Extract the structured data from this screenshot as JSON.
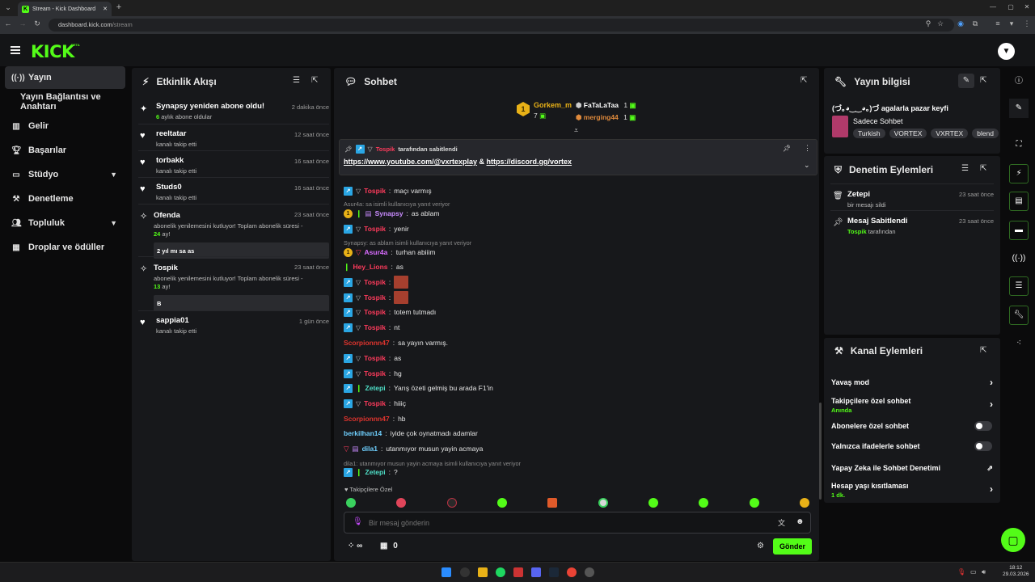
{
  "browser": {
    "tab_title": "Stream - Kick Dashboard",
    "url_host": "dashboard.kick.com",
    "url_path": "/stream"
  },
  "header": {
    "logo": "KICK",
    "beta": "BETA"
  },
  "sidebar": {
    "items": [
      {
        "label": "Yayın",
        "icon": "broadcast-icon"
      },
      {
        "label": "Yayın Bağlantısı ve Anahtarı",
        "icon": ""
      },
      {
        "label": "Gelir",
        "icon": "chart-icon"
      },
      {
        "label": "Başarılar",
        "icon": "trophy-icon"
      },
      {
        "label": "Stüdyo",
        "icon": "studio-icon"
      },
      {
        "label": "Denetleme",
        "icon": "hammer-icon"
      },
      {
        "label": "Topluluk",
        "icon": "people-icon"
      },
      {
        "label": "Droplar ve ödüller",
        "icon": "gift-icon"
      }
    ]
  },
  "activity": {
    "title": "Etkinlik Akışı",
    "items": [
      {
        "name": "Synapsy yeniden abone oldu!",
        "time": "2 dakika önce",
        "sub_num": "6",
        "sub_text": " aylık abone oldular"
      },
      {
        "name": "reeltatar",
        "time": "12 saat önce",
        "sub": "kanalı takip etti"
      },
      {
        "name": "torbakk",
        "time": "16 saat önce",
        "sub": "kanalı takip etti"
      },
      {
        "name": "Studs0",
        "time": "16 saat önce",
        "sub": "kanalı takip etti"
      },
      {
        "name": "Ofenda",
        "time": "23 saat önce",
        "sub": "abonelik yenilemesini kutluyor! Toplam abonelik süresi -",
        "num": "24",
        "unit": " ay!",
        "box": "2 yıl mı sa as"
      },
      {
        "name": "Tospik",
        "time": "23 saat önce",
        "sub": "abonelik yenilemesini kutluyor! Toplam abonelik süresi -",
        "num": "13",
        "unit": " ay!",
        "box": "B"
      },
      {
        "name": "sappia01",
        "time": "1 gün önce",
        "sub": "kanalı takip etti"
      }
    ]
  },
  "chat": {
    "title": "Sohbet",
    "leaderboard": {
      "first": "Gorkem_m",
      "first_count": "7",
      "second": "FaTaLaTaa",
      "second_count": "1",
      "third": "merging44",
      "third_count": "1"
    },
    "pinned": {
      "by": "Tospik",
      "by_suffix": "tarafından sabitlendi",
      "link1": "https://www.youtube.com/@vxrtexplay",
      "amp": "&",
      "link2": "https://discord.gg/vortex"
    },
    "messages": [
      {
        "user": "Tospik",
        "text": "maçı varmış",
        "color": "#ff3b5c"
      },
      {
        "reply": "Asur4a: sa isimli kullanıcıya yanıt veriyor"
      },
      {
        "user": "Synapsy",
        "text": "as ablam",
        "color": "#c98cff"
      },
      {
        "user": "Tospik",
        "text": "yenir",
        "color": "#ff3b5c"
      },
      {
        "reply": "Synapsy: as ablam isimli kullanıcıya yanıt veriyor"
      },
      {
        "user": "Asur4a",
        "text": "turhan abiiim",
        "color": "#d96cff"
      },
      {
        "user": "Hey_Lions",
        "text": "as",
        "color": "#ff3b5c"
      },
      {
        "user": "Tospik",
        "text": "",
        "color": "#ff3b5c"
      },
      {
        "user": "Tospik",
        "text": "",
        "color": "#ff3b5c"
      },
      {
        "user": "Tospik",
        "text": "totem tutmadı",
        "color": "#ff3b5c"
      },
      {
        "user": "Tospik",
        "text": "nt",
        "color": "#ff3b5c"
      },
      {
        "user": "Scorpionnn47",
        "text": "sa yayın varmış.",
        "color": "#e0342e"
      },
      {
        "user": "Tospik",
        "text": "as",
        "color": "#ff3b5c"
      },
      {
        "user": "Tospik",
        "text": "hg",
        "color": "#ff3b5c"
      },
      {
        "user": "Zetepi",
        "text": "Yarış özeti gelmiş bu arada F1'in",
        "color": "#4fe0c8"
      },
      {
        "user": "Tospik",
        "text": "hiiiç",
        "color": "#ff3b5c"
      },
      {
        "user": "Scorpionnn47",
        "text": "hb",
        "color": "#e0342e"
      },
      {
        "user": "berkilhan14",
        "text": "iyide çok oynatmadı adamlar",
        "color": "#6fd0ff"
      },
      {
        "user": "dila1",
        "text": "utanmıyor musun yayin acmaya",
        "color": "#6fd0ff"
      },
      {
        "reply": "dila1: utanmıyor musun yayin acmaya isimli kullanıcıya yanıt veriyor"
      },
      {
        "user": "Zetepi",
        "text": "?",
        "color": "#4fe0c8"
      }
    ],
    "followers_only": "Takipçilere Özel",
    "input_placeholder": "Bir mesaj gönderin",
    "points": "∞",
    "gift_count": "0",
    "send": "Gönder"
  },
  "stream_info": {
    "title": "Yayın bilgisi",
    "stream_title": "(づ｡◕‿‿◕｡)づ agalarla pazar keyfi",
    "category": "Sadece Sohbet",
    "tags": [
      "Turkish",
      "VORTEX",
      "VXRTEX",
      "blend"
    ]
  },
  "mod_actions": {
    "title": "Denetim Eylemleri",
    "items": [
      {
        "name": "Zetepi",
        "sub": "bir mesajı sildi",
        "time": "23 saat önce"
      },
      {
        "name": "Mesaj Sabitlendi",
        "sub_user": "Tospik",
        "sub": " tarafından",
        "time": "23 saat önce"
      }
    ]
  },
  "channel_actions": {
    "title": "Kanal Eylemleri",
    "slow": "Yavaş mod",
    "followers": "Takipçilere özel sohbet",
    "followers_sub": "Anında",
    "subscribers": "Abonelere özel sohbet",
    "emotes": "Yalnızca ifadelerle sohbet",
    "ai": "Yapay Zeka ile Sohbet Denetimi",
    "age": "Hesap yaşı kısıtlaması",
    "age_sub": "1 dk."
  },
  "taskbar": {
    "time": "18:12",
    "date": "29.03.2026"
  },
  "colors": {
    "accent": "#53fc18",
    "panel": "#17181b",
    "bg": "#0b0b0c"
  }
}
